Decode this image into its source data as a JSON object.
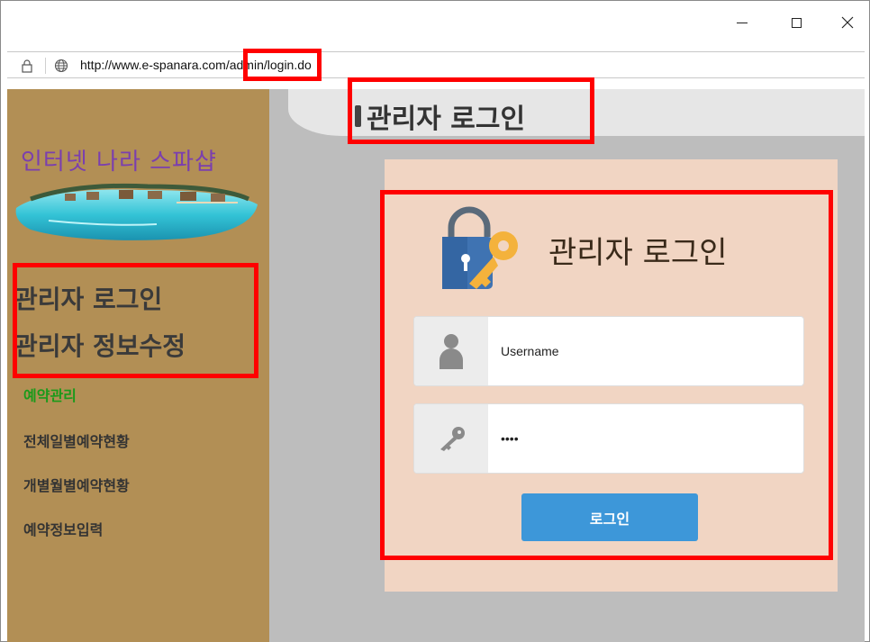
{
  "window": {
    "minimize_icon": "minimize-icon",
    "maximize_icon": "maximize-icon",
    "close_icon": "close-icon"
  },
  "address_bar": {
    "url": "http://www.e-spanara.com/admin/login.do",
    "lock_icon": "lock-icon",
    "globe_icon": "globe-icon"
  },
  "sidebar": {
    "site_title": "인터넷 나라 스파샵",
    "banner_image": "tropical-island-image",
    "admin_links": [
      "관리자 로그인",
      "관리자 정보수정"
    ],
    "section_title": "예약관리",
    "reservation_links": [
      "전체일별예약현황",
      "개별월별예약현황",
      "예약정보입력"
    ]
  },
  "header": {
    "title": "관리자 로그인"
  },
  "login": {
    "icon": "lock-key-icon",
    "title": "관리자 로그인",
    "username_placeholder": "Username",
    "username_icon": "user-icon",
    "password_value": "••••",
    "password_icon": "key-icon",
    "button_label": "로그인"
  },
  "colors": {
    "sidebar_bg": "#b28f55",
    "panel_bg": "#f1d5c3",
    "button_bg": "#3d97d9",
    "section_green": "#1a9a1a",
    "site_title_purple": "#7b3fae",
    "highlight_red": "#ff0000"
  }
}
